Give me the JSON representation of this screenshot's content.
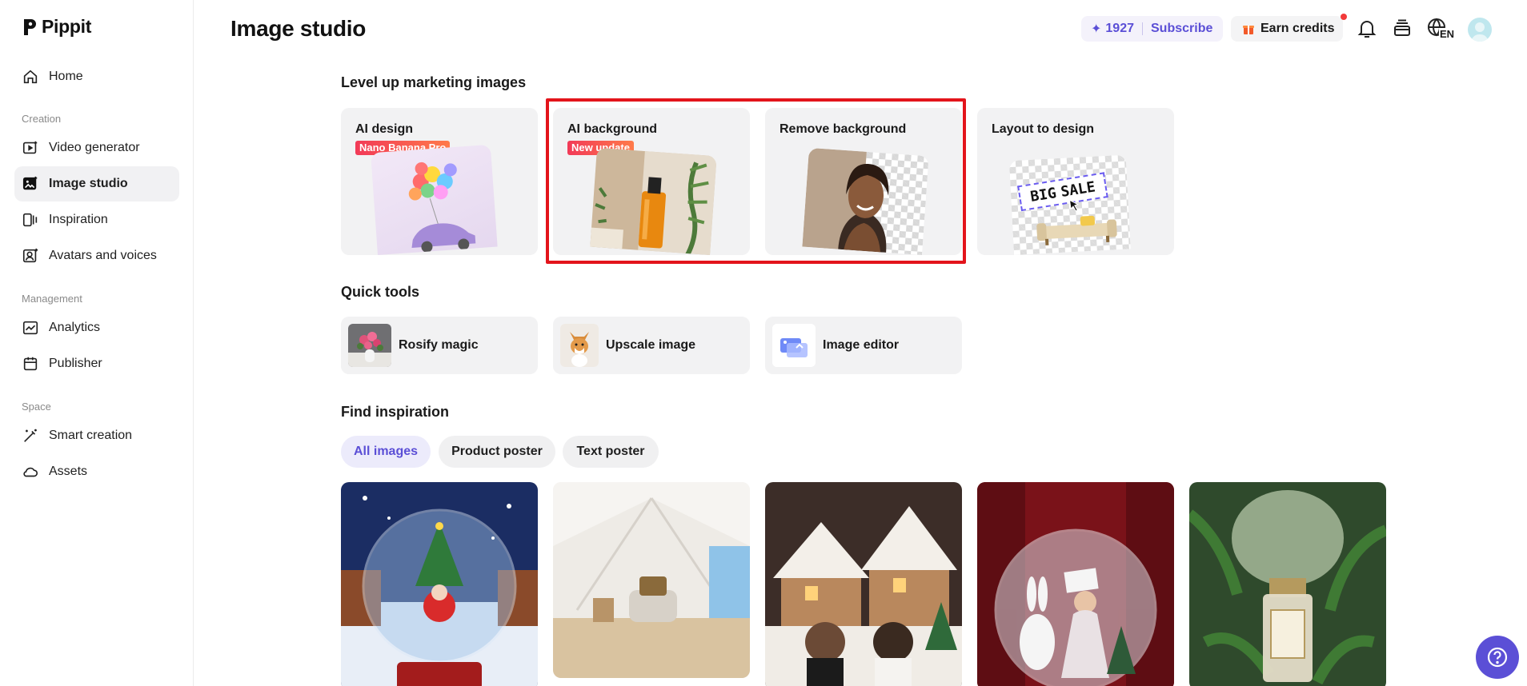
{
  "app": {
    "name": "Pippit"
  },
  "sidebar": {
    "items": [
      {
        "label": "Home"
      },
      {
        "label": "Video generator"
      },
      {
        "label": "Image studio"
      },
      {
        "label": "Inspiration"
      },
      {
        "label": "Avatars and voices"
      },
      {
        "label": "Analytics"
      },
      {
        "label": "Publisher"
      },
      {
        "label": "Smart creation"
      },
      {
        "label": "Assets"
      }
    ],
    "sections": {
      "creation": "Creation",
      "management": "Management",
      "space": "Space"
    },
    "active_item": "Image studio"
  },
  "header": {
    "title": "Image studio",
    "credits": "1927",
    "subscribe_label": "Subscribe",
    "earn_label": "Earn credits",
    "language": "EN"
  },
  "marketing": {
    "title": "Level up marketing images",
    "cards": [
      {
        "label": "AI design",
        "badge": "Nano Banana Pro"
      },
      {
        "label": "AI background",
        "badge": "New update"
      },
      {
        "label": "Remove background"
      },
      {
        "label": "Layout to design",
        "thumb_text_1": "BIG",
        "thumb_text_2": "SALE"
      }
    ]
  },
  "quick_tools": {
    "title": "Quick tools",
    "items": [
      {
        "label": "Rosify magic"
      },
      {
        "label": "Upscale image"
      },
      {
        "label": "Image editor"
      }
    ]
  },
  "inspiration": {
    "title": "Find inspiration",
    "filters": [
      {
        "label": "All images",
        "active": true
      },
      {
        "label": "Product poster",
        "active": false
      },
      {
        "label": "Text poster",
        "active": false
      }
    ]
  },
  "colors": {
    "accent": "#5b4fd6",
    "highlight": "#e3141b",
    "badge": "#f23a57"
  }
}
